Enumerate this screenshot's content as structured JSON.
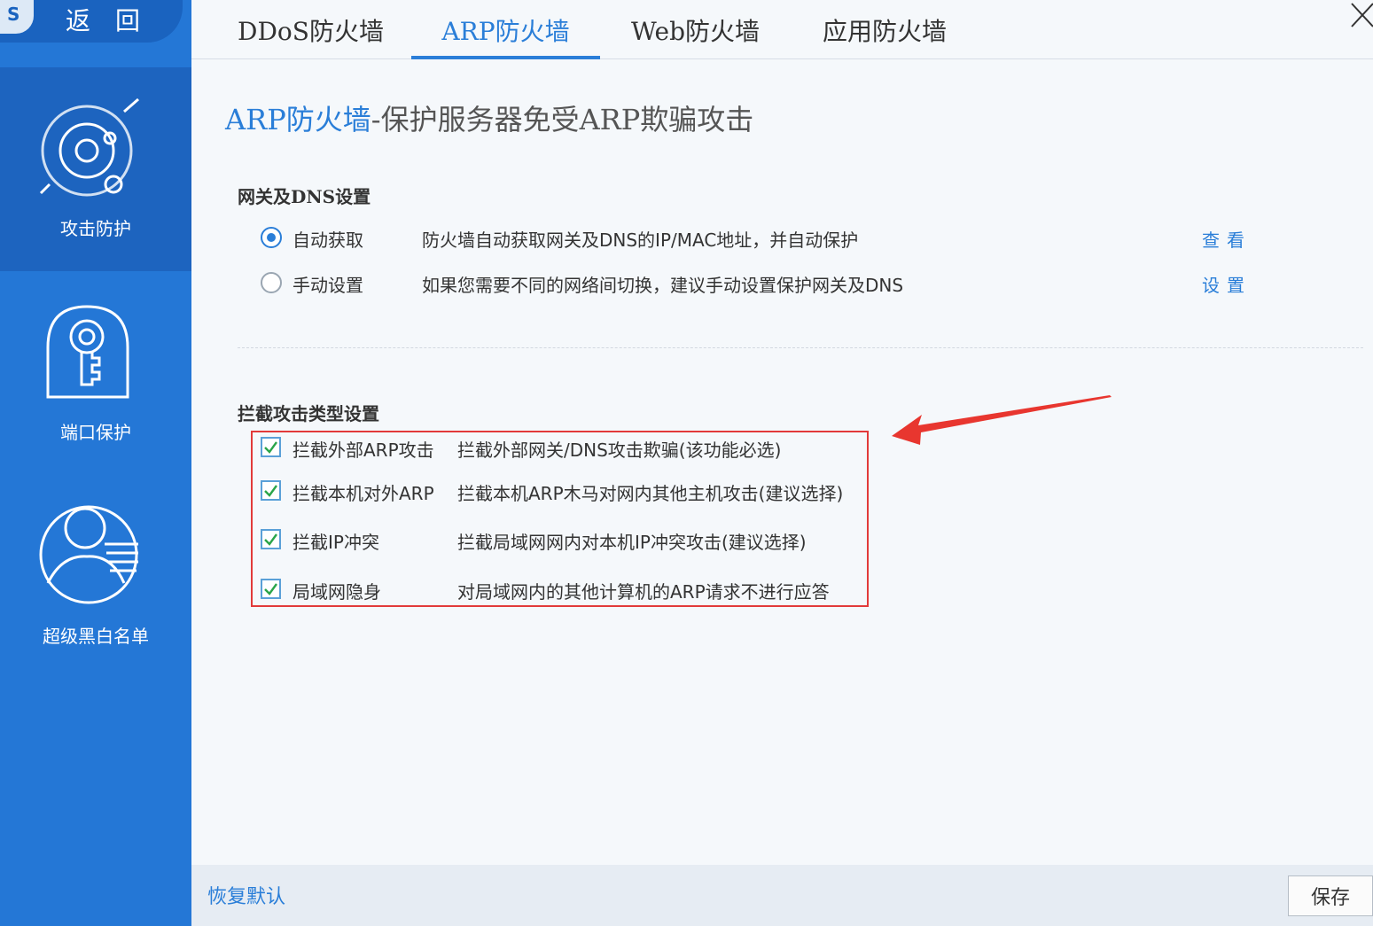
{
  "sidebar": {
    "logo_letter": "S",
    "back_label": "返回",
    "items": [
      {
        "label": "攻击防护",
        "icon": "radar-target-icon",
        "active": true
      },
      {
        "label": "端口保护",
        "icon": "key-icon",
        "active": false
      },
      {
        "label": "超级黑白名单",
        "icon": "user-list-icon",
        "active": false
      }
    ]
  },
  "tabs": [
    {
      "label": "DDoS防火墙",
      "active": false
    },
    {
      "label": "ARP防火墙",
      "active": true
    },
    {
      "label": "Web防火墙",
      "active": false
    },
    {
      "label": "应用防火墙",
      "active": false
    }
  ],
  "page": {
    "title_highlight": "ARP防火墙",
    "title_rest": "-保护服务器免受ARP欺骗攻击"
  },
  "gateway": {
    "title": "网关及DNS设置",
    "options": [
      {
        "label": "自动获取",
        "desc": "防火墙自动获取网关及DNS的IP/MAC地址，并自动保护",
        "link": "查看",
        "checked": true
      },
      {
        "label": "手动设置",
        "desc": "如果您需要不同的网络间切换，建议手动设置保护网关及DNS",
        "link": "设置",
        "checked": false
      }
    ]
  },
  "block": {
    "title": "拦截攻击类型设置",
    "items": [
      {
        "label": "拦截外部ARP攻击",
        "desc": "拦截外部网关/DNS攻击欺骗(该功能必选)",
        "checked": true
      },
      {
        "label": "拦截本机对外ARP",
        "desc": "拦截本机ARP木马对网内其他主机攻击(建议选择)",
        "checked": true
      },
      {
        "label": "拦截IP冲突",
        "desc": "拦截局域网网内对本机IP冲突攻击(建议选择)",
        "checked": true
      },
      {
        "label": "局域网隐身",
        "desc": "对局域网内的其他计算机的ARP请求不进行应答",
        "checked": true
      }
    ]
  },
  "footer": {
    "restore_label": "恢复默认",
    "save_label": "保存"
  },
  "colors": {
    "sidebar": "#2477d6",
    "sidebar_active": "#1d64bf",
    "accent": "#2a7ed8",
    "highlight_border": "#e23a3a"
  }
}
